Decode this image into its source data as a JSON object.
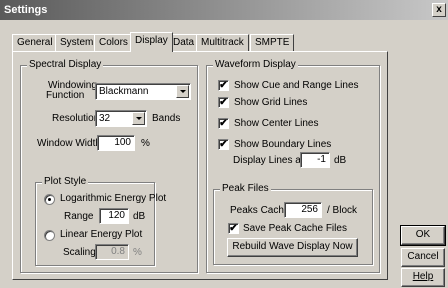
{
  "window": {
    "title": "Settings",
    "close_glyph": "x"
  },
  "tabs": [
    "General",
    "System",
    "Colors",
    "Display",
    "Data",
    "Multitrack",
    "SMPTE"
  ],
  "spectral": {
    "group_label": "Spectral Display",
    "windowing_label_1": "Windowing",
    "windowing_label_2": "Function",
    "windowing_value": "Blackmann",
    "resolution_label": "Resolution",
    "resolution_value": "32",
    "bands_label": "Bands",
    "window_width_label": "Window Width",
    "window_width_value": "100",
    "percent_label": "%"
  },
  "plot_style": {
    "group_label": "Plot Style",
    "log_label": "Logarithmic Energy Plot",
    "range_label": "Range",
    "range_value": "120",
    "db_label": "dB",
    "linear_label": "Linear Energy Plot",
    "scaling_label": "Scaling",
    "scaling_value": "0.8",
    "percent_label": "%"
  },
  "waveform": {
    "group_label": "Waveform Display",
    "cue_label": "Show Cue and Range Lines",
    "grid_label": "Show Grid Lines",
    "center_label": "Show Center Lines",
    "boundary_label": "Show Boundary Lines",
    "display_lines_label": "Display Lines at",
    "display_lines_value": "-1",
    "db_label": "dB"
  },
  "peak": {
    "group_label": "Peak Files",
    "cache_label": "Peaks Cache",
    "cache_value": "256",
    "block_label": "/ Block",
    "save_label": "Save Peak Cache Files",
    "rebuild_label": "Rebuild Wave Display Now"
  },
  "buttons": {
    "ok": "OK",
    "cancel": "Cancel",
    "help": "Help"
  },
  "check_glyph": "✔"
}
